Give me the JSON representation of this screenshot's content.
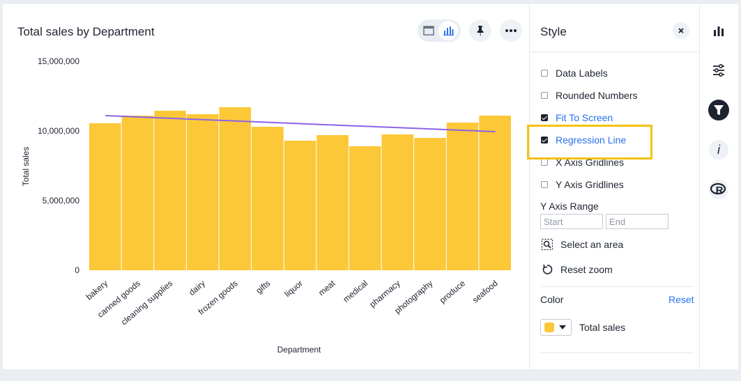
{
  "chart": {
    "title": "Total sales by Department",
    "toolbar": {
      "table_view_icon": "table-icon",
      "chart_view_icon": "bar-chart-icon",
      "pin_icon": "pin-icon",
      "more_icon": "more-icon"
    }
  },
  "chart_data": {
    "type": "bar",
    "title": "Total sales by Department",
    "xlabel": "Department",
    "ylabel": "Total sales",
    "categories": [
      "bakery",
      "canned goods",
      "cleaning supplies",
      "dairy",
      "frozen goods",
      "gifts",
      "liquor",
      "meat",
      "medical",
      "pharmacy",
      "photography",
      "produce",
      "seafood"
    ],
    "series": [
      {
        "name": "Total sales",
        "values": [
          10550000,
          11100000,
          11450000,
          11200000,
          11700000,
          10300000,
          9300000,
          9700000,
          8900000,
          9750000,
          9500000,
          10600000,
          11100000
        ]
      }
    ],
    "regression": {
      "start": 11100000,
      "end": 9950000,
      "color": "#8b63e8"
    },
    "ylim": [
      0,
      15000000
    ],
    "y_ticks": [
      "0",
      "5,000,000",
      "10,000,000",
      "15,000,000"
    ],
    "bar_color": "#fcc838",
    "grid": false,
    "legend": "none"
  },
  "style_panel": {
    "title": "Style",
    "close_icon": "close-icon",
    "options": [
      {
        "label": "Data Labels",
        "checked": false
      },
      {
        "label": "Rounded Numbers",
        "checked": false
      },
      {
        "label": "Fit To Screen",
        "checked": true
      },
      {
        "label": "Regression Line",
        "checked": true
      },
      {
        "label": "X Axis Gridlines",
        "checked": false
      },
      {
        "label": "Y Axis Gridlines",
        "checked": false
      }
    ],
    "y_axis_range": {
      "label": "Y Axis Range",
      "start_placeholder": "Start",
      "end_placeholder": "End"
    },
    "select_area": "Select an area",
    "reset_zoom": "Reset zoom",
    "color": {
      "label": "Color",
      "reset": "Reset",
      "series_name": "Total sales",
      "swatch_color": "#fcc838"
    }
  },
  "rail": {
    "icons": [
      "bar-chart-icon",
      "settings-sliders-icon",
      "filter-icon",
      "info-icon",
      "r-icon"
    ]
  }
}
